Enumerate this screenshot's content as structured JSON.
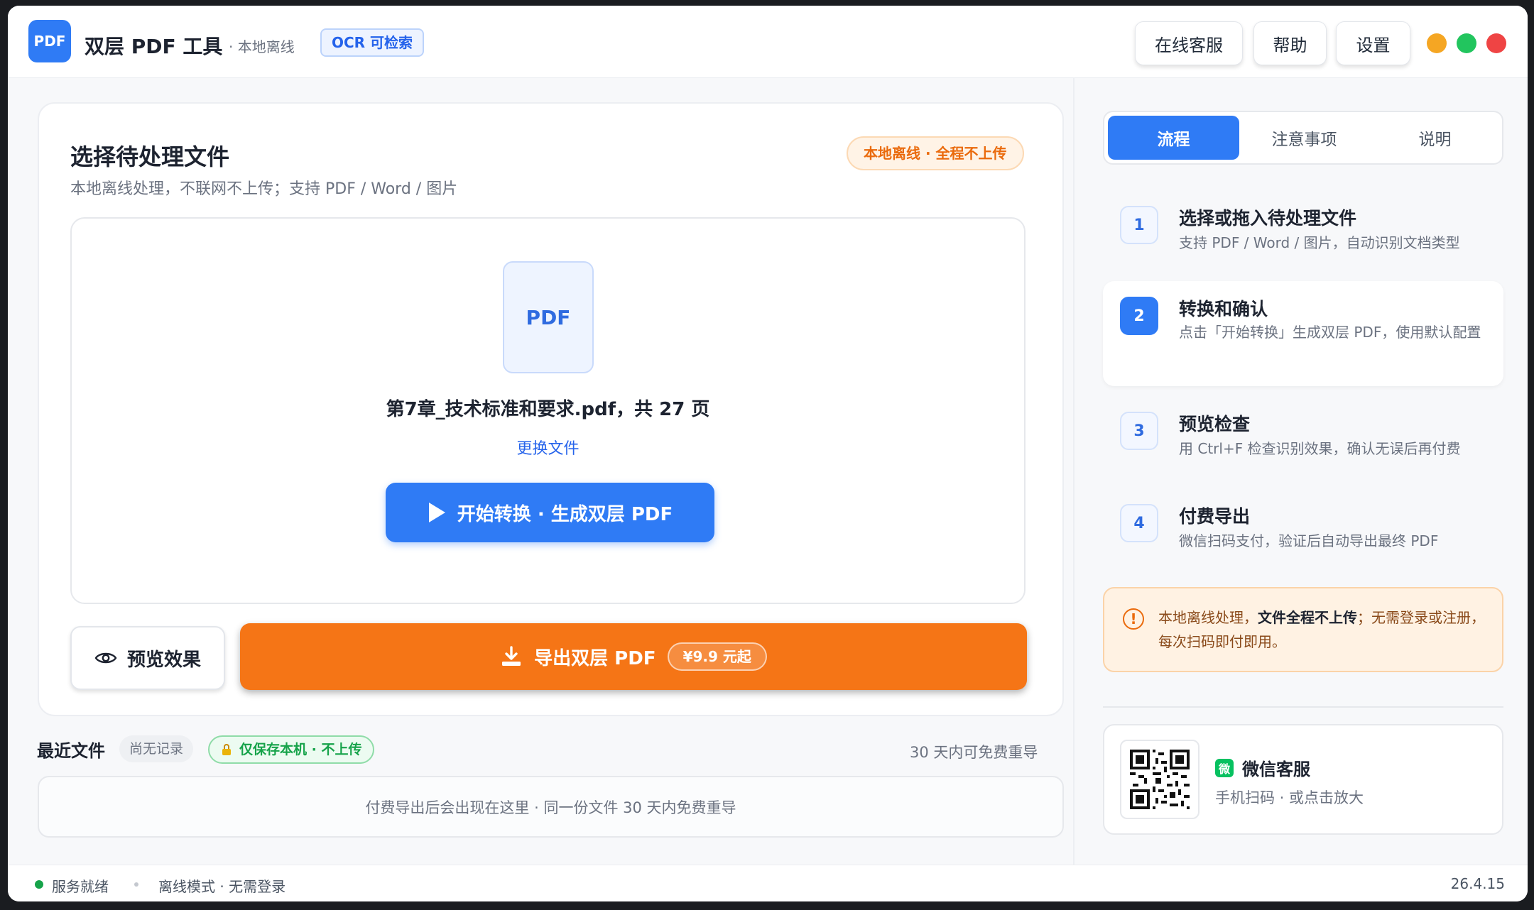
{
  "header": {
    "logo_text": "PDF",
    "title": "双层 PDF 工具",
    "subtitle": "· 本地离线",
    "ocr_badge": "OCR 可检索",
    "buttons": {
      "support": "在线客服",
      "help": "帮助",
      "settings": "设置"
    },
    "window_controls": {
      "minimize_color": "#f5a623",
      "maximize_color": "#22c55e",
      "close_color": "#ef4444"
    }
  },
  "main": {
    "title": "选择待处理文件",
    "subtitle": "本地离线处理，不联网不上传；支持 PDF / Word / 图片",
    "offline_badge": "本地离线 · 全程不上传",
    "file": {
      "icon_label": "PDF",
      "name": "第7章_技术标准和要求.pdf，共 27 页",
      "change_link": "更换文件"
    },
    "start_button": "开始转换 · 生成双层 PDF",
    "preview_button": "预览效果",
    "export_button": "导出双层 PDF",
    "export_price": "¥9.9 元起"
  },
  "recent": {
    "title": "最近文件",
    "empty_tag": "尚无记录",
    "local_tag": "仅保存本机 · 不上传",
    "right_note": "30 天内可免费重导",
    "empty_message": "付费导出后会出现在这里 · 同一份文件 30 天内免费重导"
  },
  "side": {
    "tabs": [
      "流程",
      "注意事项",
      "说明"
    ],
    "steps": [
      {
        "num": "1",
        "title": "选择或拖入待处理文件",
        "desc": "支持 PDF / Word / 图片，自动识别文档类型"
      },
      {
        "num": "2",
        "title": "转换和确认",
        "desc": "点击「开始转换」生成双层 PDF，使用默认配置"
      },
      {
        "num": "3",
        "title": "预览检查",
        "desc": "用 Ctrl+F 检查识别效果，确认无误后再付费"
      },
      {
        "num": "4",
        "title": "付费导出",
        "desc": "微信扫码支付，验证后自动导出最终 PDF"
      }
    ],
    "notice": {
      "icon": "!",
      "part1": "本地离线处理，",
      "bold": "文件全程不上传",
      "part2": "；无需登录或注册，每次扫码即付即用。"
    },
    "wechat": {
      "logo": "微",
      "title": "微信客服",
      "subtitle": "手机扫码 · 或点击放大"
    }
  },
  "status": {
    "ready": "服务就绪",
    "mode": "离线模式 · 无需登录",
    "version": "26.4.15"
  },
  "colors": {
    "primary": "#2f7bf5",
    "accent_orange": "#f57516",
    "success": "#16a34a"
  }
}
